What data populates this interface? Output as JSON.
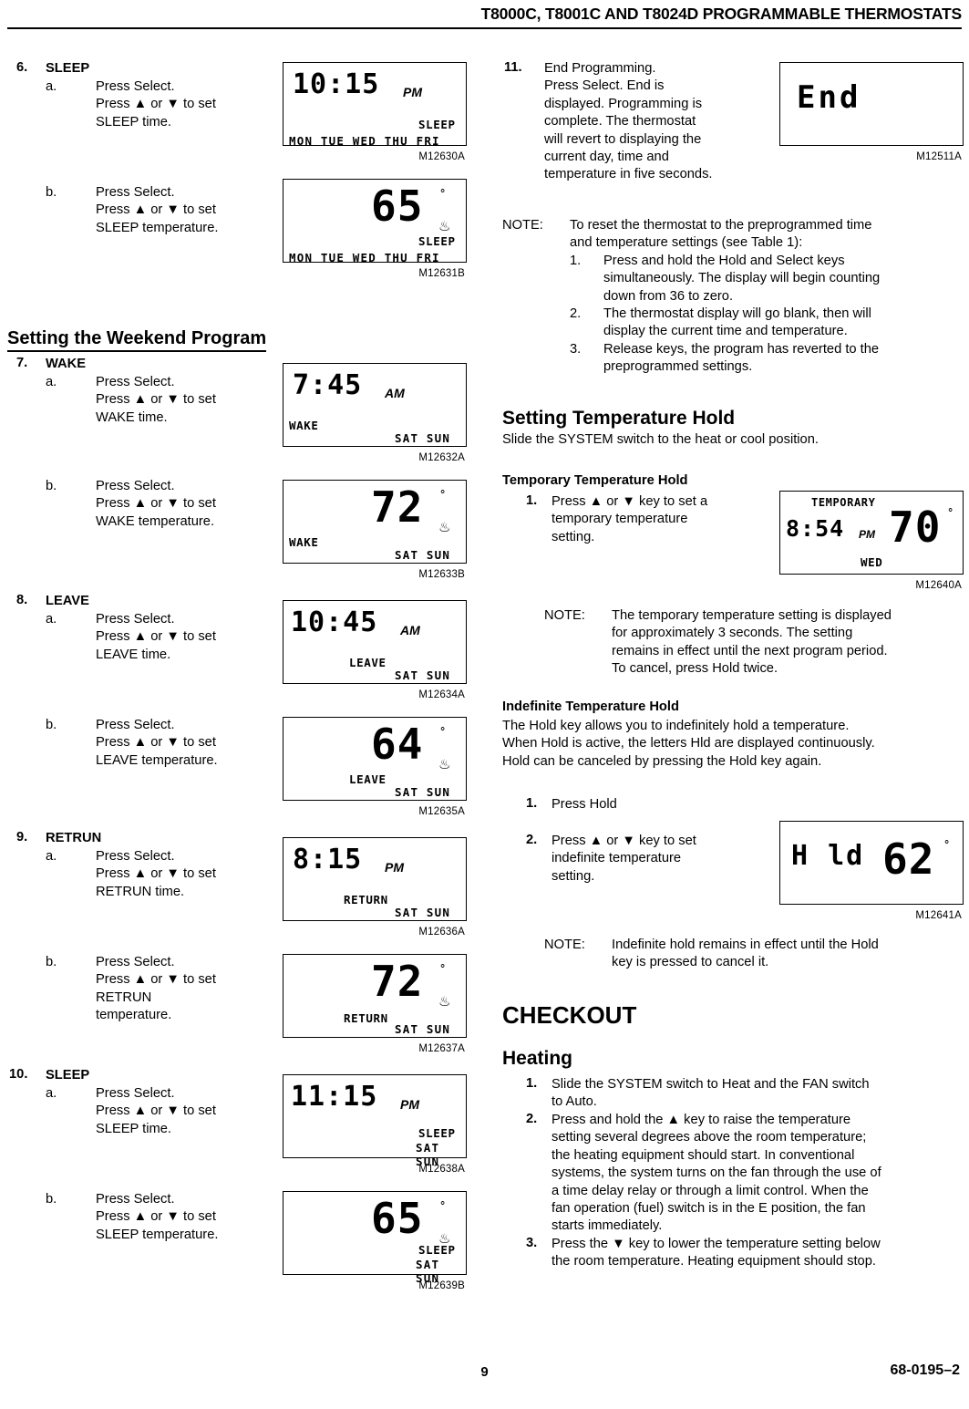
{
  "header": {
    "title": "T8000C, T8001C AND T8024D PROGRAMMABLE THERMOSTATS"
  },
  "footer": {
    "page_number": "9",
    "doc_code": "68-0195–2"
  },
  "left_column": {
    "step6": {
      "num": "6.",
      "title": "SLEEP",
      "a_label": "a.",
      "a_text": "Press Select.\nPress ▲ or ▼ to set\nSLEEP time.",
      "b_label": "b.",
      "b_text": "Press Select.\nPress ▲ or ▼ to set\nSLEEP temperature."
    },
    "section_weekend": "Setting the Weekend Program",
    "step7": {
      "num": "7.",
      "title": "WAKE",
      "a_label": "a.",
      "a_text": "Press Select.\nPress ▲ or ▼ to set\nWAKE time.",
      "b_label": "b.",
      "b_text": "Press Select.\nPress ▲ or ▼ to set\nWAKE temperature."
    },
    "step8": {
      "num": "8.",
      "title": "LEAVE",
      "a_label": "a.",
      "a_text": "Press Select.\nPress ▲ or ▼ to set\nLEAVE time.",
      "b_label": "b.",
      "b_text": "Press Select.\nPress ▲ or ▼ to set\nLEAVE temperature."
    },
    "step9": {
      "num": "9.",
      "title": "RETRUN",
      "a_label": "a.",
      "a_text": "Press Select.\nPress ▲ or ▼ to set\nRETRUN time.",
      "b_label": "b.",
      "b_text": "Press Select.\nPress ▲ or ▼ to set\nRETRUN\ntemperature."
    },
    "step10": {
      "num": "10.",
      "title": "SLEEP",
      "a_label": "a.",
      "a_text": "Press Select.\nPress ▲ or ▼ to set\nSLEEP time.",
      "b_label": "b.",
      "b_text": "Press Select.\nPress ▲ or ▼ to set\nSLEEP temperature."
    },
    "figures": [
      {
        "code": "M12630A",
        "time": "10:15",
        "ampm": "PM",
        "days": "MON TUE WED THU  FRI",
        "mode": "SLEEP",
        "mode_pos": "right"
      },
      {
        "code": "M12631B",
        "temp": "65",
        "days": "MON TUE WED THU  FRI",
        "mode": "SLEEP",
        "mode_pos": "right"
      },
      {
        "code": "M12632A",
        "time": "7:45",
        "ampm": "AM",
        "days": "SAT  SUN",
        "mode": "WAKE",
        "mode_pos": "left"
      },
      {
        "code": "M12633B",
        "temp": "72",
        "days": "SAT  SUN",
        "mode": "WAKE",
        "mode_pos": "left"
      },
      {
        "code": "M12634A",
        "time": "10:45",
        "ampm": "AM",
        "days": "SAT  SUN",
        "mode": "LEAVE",
        "mode_pos": "mid"
      },
      {
        "code": "M12635A",
        "temp": "64",
        "days": "SAT  SUN",
        "mode": "LEAVE",
        "mode_pos": "mid"
      },
      {
        "code": "M12636A",
        "time": "8:15",
        "ampm": "PM",
        "days": "SAT  SUN",
        "mode": "RETURN",
        "mode_pos": "mid"
      },
      {
        "code": "M12637A",
        "temp": "72",
        "days": "SAT  SUN",
        "mode": "RETURN",
        "mode_pos": "mid"
      },
      {
        "code": "M12638A",
        "time": "11:15",
        "ampm": "PM",
        "days": "SAT  SUN",
        "mode": "SLEEP",
        "mode_pos": "stack"
      },
      {
        "code": "M12639B",
        "temp": "65",
        "days": "SAT  SUN",
        "mode": "SLEEP",
        "mode_pos": "stack"
      }
    ]
  },
  "right_column": {
    "step11": {
      "num": "11.",
      "text": "End Programming.\nPress Select. End is\ndisplayed. Programming is\ncomplete. The thermostat\nwill revert to displaying the\ncurrent day, time and\ntemperature in five seconds."
    },
    "fig_end": {
      "code": "M12511A",
      "display": "End"
    },
    "note_reset": {
      "label": "NOTE:",
      "text": "To reset the thermostat to the preprogrammed time\nand temperature settings (see Table 1):",
      "items": [
        {
          "num": "1.",
          "text": "Press and hold the Hold and Select keys\nsimultaneously. The display will begin counting\ndown from 36 to zero."
        },
        {
          "num": "2.",
          "text": "The thermostat display will go blank, then will\ndisplay the current time and temperature."
        },
        {
          "num": "3.",
          "text": "Release keys, the program has reverted to the\npreprogrammed settings."
        }
      ]
    },
    "section_hold": {
      "heading": "Setting Temperature Hold",
      "text": "Slide the SYSTEM switch to the heat or cool position."
    },
    "temporary": {
      "heading": "Temporary Temperature Hold",
      "step_num": "1.",
      "step_text": "Press ▲ or ▼ key to set a\ntemporary temperature\nsetting.",
      "note_label": "NOTE:",
      "note_text": "The temporary temperature setting is displayed\nfor approximately 3 seconds. The setting\nremains in effect until the next program period.\nTo cancel, press Hold twice."
    },
    "fig_temporary": {
      "code": "M12640A",
      "banner": "TEMPORARY",
      "time": "8:54",
      "ampm": "PM",
      "temp": "70",
      "day": "WED"
    },
    "indefinite": {
      "heading": "Indefinite Temperature Hold",
      "text": "The Hold key allows you to indefinitely hold a temperature.\nWhen Hold is active, the letters Hld are displayed continuously.\nHold can be canceled by pressing the Hold key again.",
      "step1_num": "1.",
      "step1_text": "Press Hold",
      "step2_num": "2.",
      "step2_text": "Press ▲ or ▼ key to set\nindefinite temperature\nsetting.",
      "note_label": "NOTE:",
      "note_text": "Indefinite hold remains in effect until the Hold\nkey is pressed to cancel it."
    },
    "fig_indefinite": {
      "code": "M12641A",
      "hold_text": "H ld",
      "temp": "62"
    },
    "checkout": {
      "heading": "CHECKOUT",
      "sub_heading": "Heating",
      "items": [
        {
          "num": "1.",
          "text": "Slide the SYSTEM switch to Heat and the FAN switch\nto Auto."
        },
        {
          "num": "2.",
          "text": "Press and hold the ▲ key to raise the temperature\nsetting several degrees above the room temperature;\nthe heating equipment should start. In conventional\nsystems, the system turns on the fan through the use of\na time delay relay or through a limit control. When the\nfan operation (fuel) switch is in the E position, the fan\nstarts immediately."
        },
        {
          "num": "3.",
          "text": "Press the ▼ key to lower the temperature setting below\nthe room temperature. Heating equipment should stop."
        }
      ]
    }
  }
}
